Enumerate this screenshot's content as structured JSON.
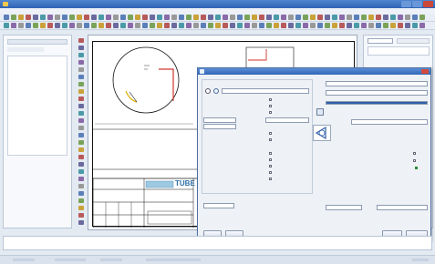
{
  "app": {
    "title": ""
  },
  "colors": {
    "titlebar": "#3b6fc1",
    "accent": "#3166b8",
    "dialog_bg": "#eef1f5",
    "red_guide": "#d0362c"
  },
  "toolbar_icons": [
    "new-icon",
    "open-icon",
    "save-icon",
    "print-icon",
    "cut-icon",
    "copy-icon",
    "paste-icon",
    "undo-icon",
    "redo-icon",
    "zoom-icon",
    "pan-icon",
    "layer-icon",
    "line-icon",
    "circle-icon",
    "arc-icon",
    "text-icon",
    "dimension-icon",
    "hatch-icon",
    "block-icon",
    "properties-icon"
  ],
  "dialog": {
    "title": "",
    "ok_label": "",
    "cancel_label": "",
    "apply_label": "",
    "help_label": ""
  },
  "title_block": {
    "logo_text": "TUBE"
  },
  "command": {
    "text": ""
  },
  "status": {
    "coords": "",
    "mode": "",
    "grid": "",
    "snap": ""
  }
}
